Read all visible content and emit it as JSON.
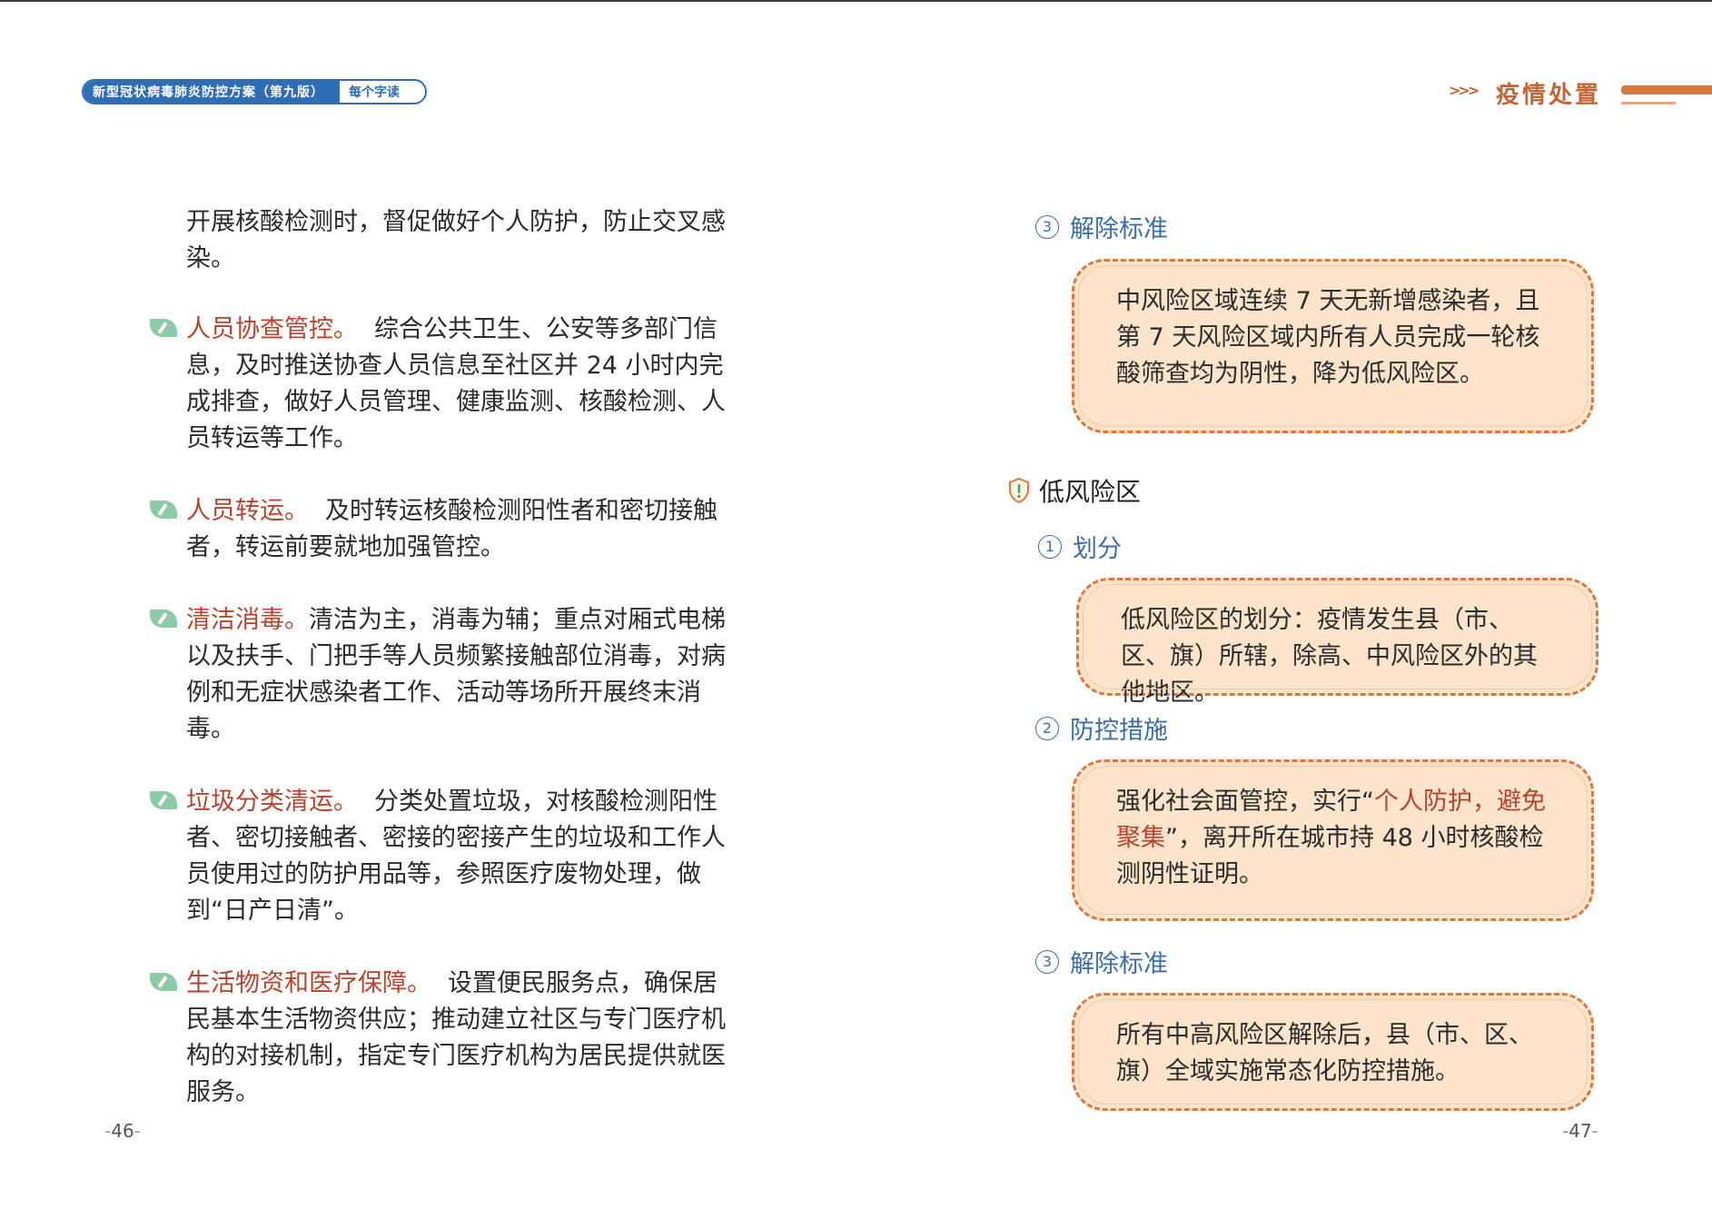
{
  "header": {
    "book_title": "新型冠状病毒肺炎防控方案（第九版）",
    "book_tag": "每个字读",
    "section_title": "疫情处置"
  },
  "left": {
    "intro_text": "开展核酸检测时，督促做好个人防护，防止交叉感染。",
    "items": [
      {
        "title": "人员协查管控。",
        "text": "综合公共卫生、公安等多部门信息，及时推送协查人员信息至社区并 24 小时内完成排查，做好人员管理、健康监测、核酸检测、人员转运等工作。"
      },
      {
        "title": "人员转运。",
        "text": "及时转运核酸检测阳性者和密切接触者，转运前要就地加强管控。"
      },
      {
        "title": "清洁消毒。",
        "text": "清洁为主，消毒为辅；重点对厢式电梯以及扶手、门把手等人员频繁接触部位消毒，对病例和无症状感染者工作、活动等场所开展终末消毒。"
      },
      {
        "title": "垃圾分类清运。",
        "text": "分类处置垃圾，对核酸检测阳性者、密切接触者、密接的密接产生的垃圾和工作人员使用过的防护用品等，参照医疗废物处理，做到“日产日清”。"
      },
      {
        "title": "生活物资和医疗保障。",
        "text": "设置便民服务点，确保居民基本生活物资供应；推动建立社区与专门医疗机构的对接机制，指定专门医疗机构为居民提供就医服务。"
      }
    ],
    "page_number": "46"
  },
  "right": {
    "mid_release": {
      "num": "3",
      "label": "解除标准",
      "text": "中风险区域连续 7 天无新增感染者，且第 7 天风险区域内所有人员完成一轮核酸筛查均为阴性，降为低风险区。"
    },
    "low_risk_title": "低风险区",
    "division": {
      "num": "1",
      "label": "划分",
      "text": "低风险区的划分：疫情发生县（市、区、旗）所辖，除高、中风险区外的其他地区。"
    },
    "measures": {
      "num": "2",
      "label": "防控措施",
      "text_before": "强化社会面管控，实行“",
      "text_highlight": "个人防护，避免聚集",
      "text_after": "”，离开所在城市持 48 小时核酸检测阴性证明。"
    },
    "low_release": {
      "num": "3",
      "label": "解除标准",
      "text": "所有中高风险区解除后，县（市、区、旗）全域实施常态化防控措施。"
    },
    "page_number": "47"
  },
  "colors": {
    "header_blue": "#2f6db5",
    "accent_orange": "#d9783f",
    "card_fill": "#fde4cb",
    "highlight_red": "#b5442f",
    "subhead_blue": "#3d6ea6",
    "leaf_green": "#8ccaa8"
  },
  "icons": {
    "bullet": "leaf-icon",
    "section": "shield-alert-icon"
  }
}
